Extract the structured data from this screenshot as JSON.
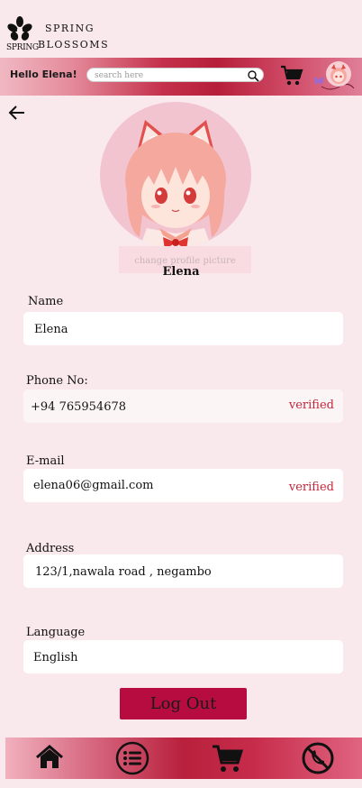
{
  "brand": {
    "mark_text": "SPRING",
    "line1": "SPRING",
    "line2": "BLOSSOMS"
  },
  "topbar": {
    "greeting": "Hello Elena!",
    "search_placeholder": "search here",
    "icons": [
      "search-icon",
      "cart-icon",
      "avatar",
      "butterfly-icon"
    ]
  },
  "profile": {
    "change_picture": "change profile picture",
    "name": "Elena"
  },
  "form": {
    "name_label": "Name",
    "name_value": "Elena",
    "phone_label": "Phone No:",
    "phone_value": "+94 765954678",
    "phone_status": "verified",
    "email_label": "E-mail",
    "email_value": "elena06@gmail.com",
    "email_status": "verified",
    "address_label": "Address",
    "address_value": "123/1,nawala road , negambo",
    "language_label": "Language",
    "language_value": "English"
  },
  "actions": {
    "logout": "Log Out"
  },
  "bottom_nav": [
    "home-icon",
    "menu-list-icon",
    "cart-icon",
    "phone-icon"
  ],
  "colors": {
    "accent": "#b70c40",
    "verified": "#c2263a",
    "background": "#f9e8ec"
  }
}
